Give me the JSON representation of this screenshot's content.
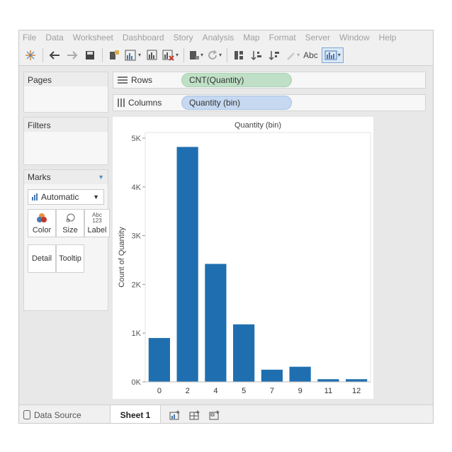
{
  "menu": [
    "File",
    "Data",
    "Worksheet",
    "Dashboard",
    "Story",
    "Analysis",
    "Map",
    "Format",
    "Server",
    "Window",
    "Help"
  ],
  "toolbar": {
    "icons": [
      "tableau-logo-icon",
      "undo-icon",
      "redo-icon",
      "save-icon",
      "new-data-source-icon",
      "new-worksheet-icon",
      "duplicate-sheet-icon",
      "clear-sheet-icon",
      "group-icon",
      "refresh-icon",
      "swap-icon",
      "sort-ascending-icon",
      "sort-descending-icon",
      "highlight-icon",
      "show-me-icon"
    ],
    "labels_button": "Abc"
  },
  "panes": {
    "pages": "Pages",
    "filters": "Filters",
    "marks": "Marks"
  },
  "marks": {
    "type": "Automatic",
    "cards": {
      "color": "Color",
      "size": "Size",
      "label": "Label",
      "label_icon_text": "Abc\n123",
      "detail": "Detail",
      "tooltip": "Tooltip"
    }
  },
  "shelves": {
    "rows_label": "Rows",
    "rows_pill": "CNT(Quantity)",
    "columns_label": "Columns",
    "columns_pill": "Quantity (bin)"
  },
  "colors": {
    "bar": "#1f6fb0",
    "rows_pill": "#bfe0c6",
    "columns_pill": "#c6d9f1"
  },
  "chart_data": {
    "type": "bar",
    "title": "Quantity (bin)",
    "xlabel": "",
    "ylabel": "Count of Quantity",
    "categories": [
      "0",
      "2",
      "4",
      "5",
      "7",
      "9",
      "11",
      "12"
    ],
    "values": [
      900,
      4820,
      2420,
      1180,
      250,
      310,
      55,
      55
    ],
    "ylim": [
      0,
      5000
    ],
    "yticks": [
      0,
      1000,
      2000,
      3000,
      4000,
      5000
    ],
    "ytick_labels": [
      "0K",
      "1K",
      "2K",
      "3K",
      "4K",
      "5K"
    ],
    "grid": false
  },
  "tabs": {
    "data_source": "Data Source",
    "sheet": "Sheet 1"
  }
}
